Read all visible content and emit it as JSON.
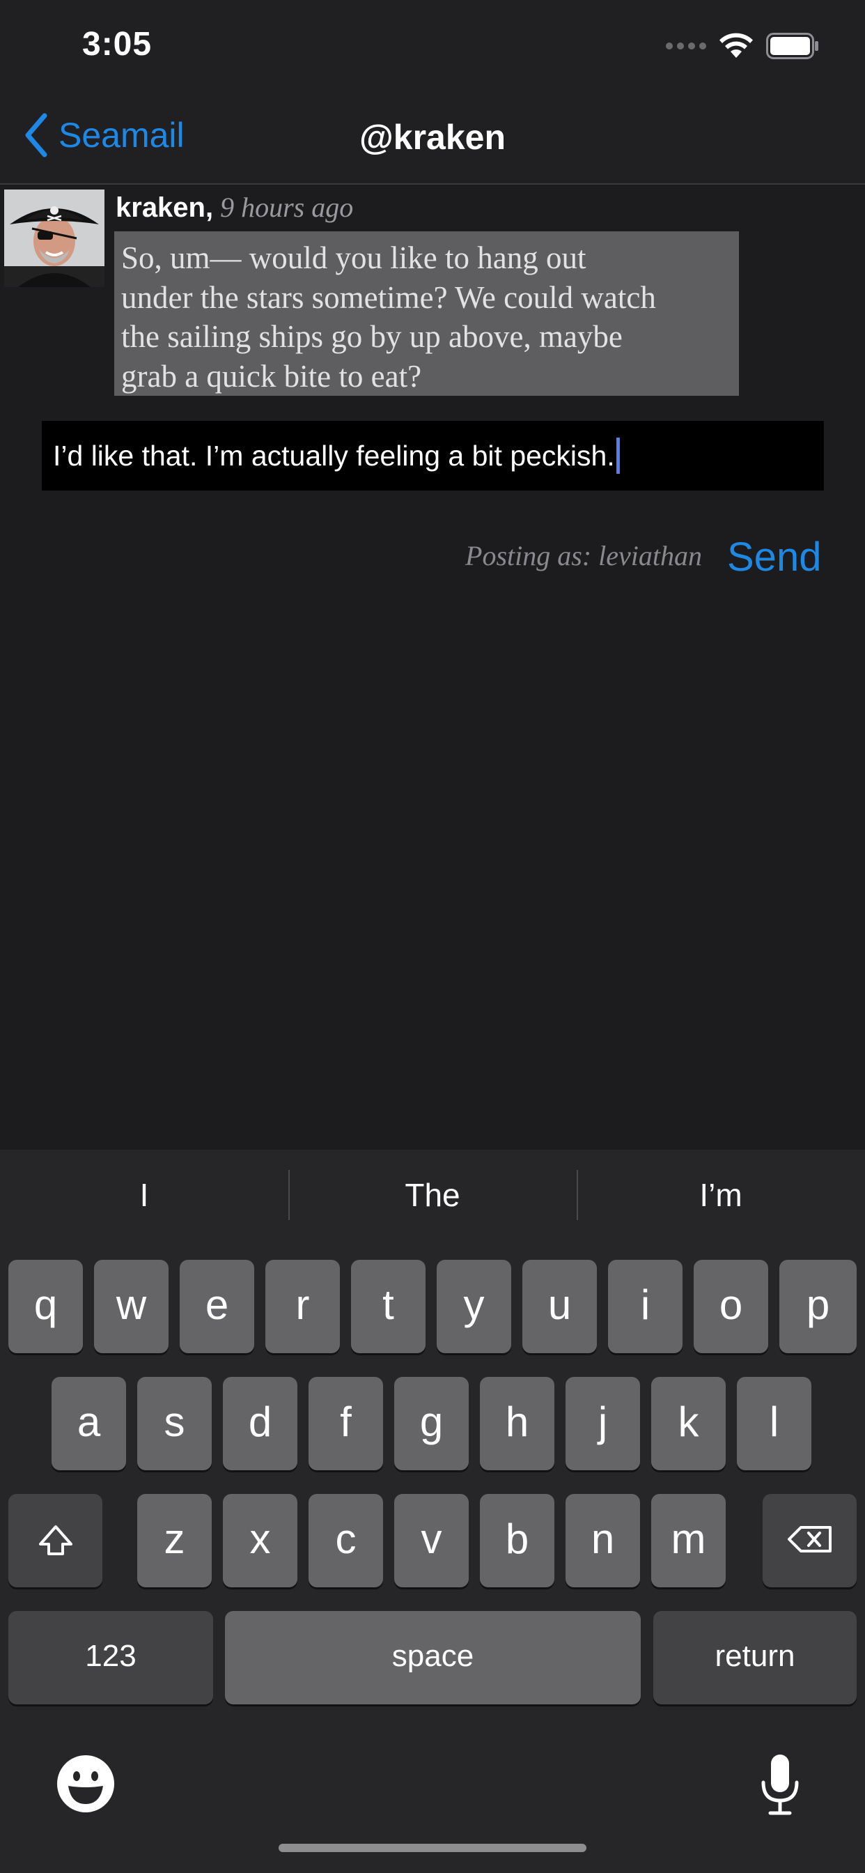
{
  "status_bar": {
    "time": "3:05"
  },
  "nav": {
    "back_label": "Seamail",
    "title": "@kraken"
  },
  "message": {
    "author": "kraken,",
    "time": "9 hours ago",
    "lines": [
      "So, um— would you like to hang out",
      "under the stars sometime? We could watch",
      "the sailing ships go by up above, maybe",
      "grab a quick bite to eat?"
    ]
  },
  "reply": {
    "value": "I’d like that. I’m actually feeling a bit peckish.",
    "posting_as": "Posting as: leviathan",
    "send_label": "Send"
  },
  "keyboard": {
    "suggestions": [
      "I",
      "The",
      "I’m"
    ],
    "row1": [
      "q",
      "w",
      "e",
      "r",
      "t",
      "y",
      "u",
      "i",
      "o",
      "p"
    ],
    "row2": [
      "a",
      "s",
      "d",
      "f",
      "g",
      "h",
      "j",
      "k",
      "l"
    ],
    "row3": [
      "z",
      "x",
      "c",
      "v",
      "b",
      "n",
      "m"
    ],
    "numbers_label": "123",
    "space_label": "space",
    "return_label": "return"
  },
  "colors": {
    "accent": "#1e88e5",
    "bubble": "#5e5e60",
    "caret": "#5a7cf0"
  }
}
